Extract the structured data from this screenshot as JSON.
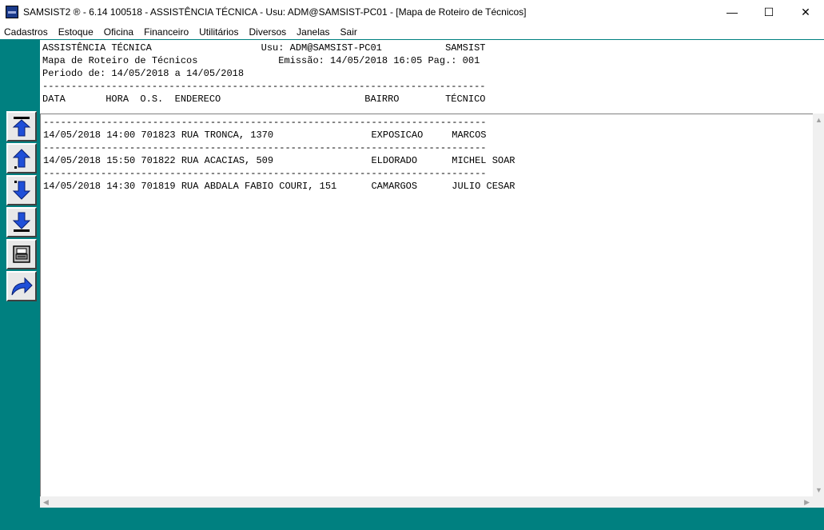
{
  "window": {
    "title": "SAMSIST2 ® - 6.14  100518 - ASSISTÊNCIA TÉCNICA - Usu: ADM@SAMSIST-PC01 - [Mapa de Roteiro de Técnicos]",
    "minimize": "—",
    "maximize": "☐",
    "close": "✕"
  },
  "menu": [
    "Cadastros",
    "Estoque",
    "Oficina",
    "Financeiro",
    "Utilitários",
    "Diversos",
    "Janelas",
    "Sair"
  ],
  "toolbar": [
    "first-page-icon",
    "previous-page-icon",
    "next-page-icon",
    "last-page-icon",
    "print-icon",
    "exit-icon"
  ],
  "report": {
    "header": {
      "line1": "ASSISTÊNCIA TÉCNICA                   Usu: ADM@SAMSIST-PC01           SAMSIST",
      "line2": "Mapa de Roteiro de Técnicos              Emissão: 14/05/2018 16:05 Pag.: 001",
      "line3": "Periodo de: 14/05/2018 a 14/05/2018",
      "separator": "-----------------------------------------------------------------------------",
      "columns": "DATA       HORA  O.S.  ENDERECO                         BAIRRO        TÉCNICO"
    },
    "body": {
      "separator": "-----------------------------------------------------------------------------",
      "rows": [
        "14/05/2018 14:00 701823 RUA TRONCA, 1370                 EXPOSICAO     MARCOS",
        "14/05/2018 15:50 701822 RUA ACACIAS, 509                 ELDORADO      MICHEL SOAR",
        "14/05/2018 14:30 701819 RUA ABDALA FABIO COURI, 151      CAMARGOS      JULIO CESAR"
      ]
    }
  },
  "colors": {
    "background": "#008080",
    "report_bg": "#ffffff",
    "icon_blue": "#1f4fd8"
  }
}
